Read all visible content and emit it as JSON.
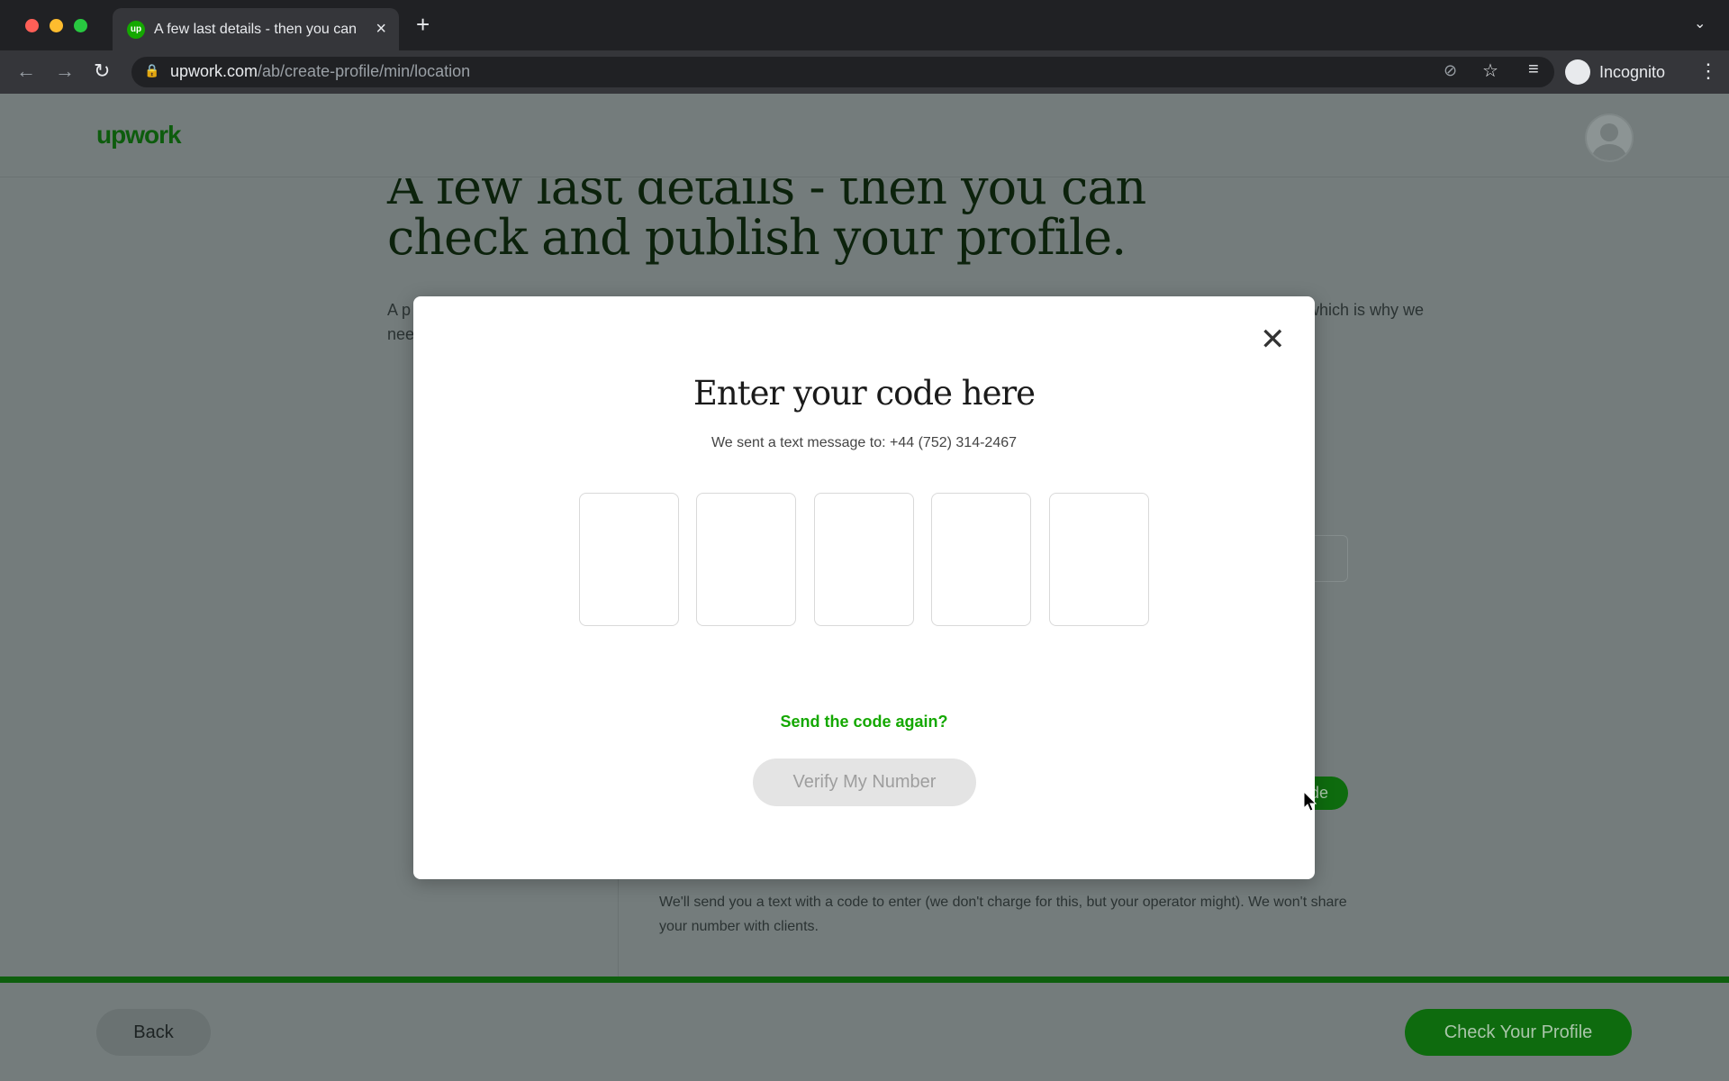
{
  "browser": {
    "tab_title": "A few last details - then you can check and publish your profile.",
    "tab_favicon": "up",
    "url_domain": "upwork.com",
    "url_path": "/ab/create-profile/min/location",
    "profile_label": "Incognito"
  },
  "page": {
    "logo": "upwork",
    "heading": "A few last details - then you can check and publish your profile.",
    "intro_start": "A p",
    "intro_start2": "nee",
    "intro_end": "which is why we",
    "phone_note": "We'll send you a text with a code to enter (we don't charge for this, but your operator might). We won't share your number with clients.",
    "send_code_button": "Send Code",
    "back_button": "Back",
    "check_profile_button": "Check Your Profile",
    "progress_percent": 100
  },
  "modal": {
    "title": "Enter your code here",
    "subtitle": "We sent a text message to: +44 (752) 314-2467",
    "code_digits": [
      "",
      "",
      "",
      "",
      ""
    ],
    "resend_link": "Send the code again?",
    "verify_button": "Verify My Number"
  },
  "colors": {
    "brand": "#14a800",
    "overlay": "#747c7c"
  }
}
